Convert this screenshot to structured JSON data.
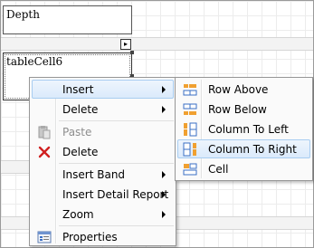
{
  "designer": {
    "cells": [
      {
        "text": "Depth"
      },
      {
        "text": "tableCell6"
      }
    ]
  },
  "context_menu": {
    "items": [
      {
        "label": "Insert",
        "icon": "none",
        "enabled": true,
        "submenu": true,
        "highlighted": false
      },
      {
        "label": "Delete",
        "icon": "none",
        "enabled": true,
        "submenu": true,
        "highlighted": false
      },
      {
        "label": "Paste",
        "icon": "paste-icon",
        "enabled": false,
        "submenu": false
      },
      {
        "label": "Delete",
        "icon": "delete-x-icon",
        "enabled": true,
        "submenu": false
      },
      {
        "label": "Insert Band",
        "icon": "none",
        "enabled": true,
        "submenu": true
      },
      {
        "label": "Insert Detail Report",
        "icon": "none",
        "enabled": true,
        "submenu": true
      },
      {
        "label": "Zoom",
        "icon": "none",
        "enabled": true,
        "submenu": true
      },
      {
        "label": "Properties",
        "icon": "properties-icon",
        "enabled": true,
        "submenu": false
      }
    ]
  },
  "insert_submenu": {
    "items": [
      {
        "label": "Row Above",
        "icon": "row-above-icon",
        "highlighted": false
      },
      {
        "label": "Row Below",
        "icon": "row-below-icon",
        "highlighted": false
      },
      {
        "label": "Column To Left",
        "icon": "column-left-icon",
        "highlighted": false
      },
      {
        "label": "Column To Right",
        "icon": "column-right-icon",
        "highlighted": true
      },
      {
        "label": "Cell",
        "icon": "cell-icon",
        "highlighted": false
      }
    ]
  },
  "colors": {
    "highlight_bg": "#dbeafb",
    "highlight_border": "#a8cdf1",
    "icon_orange": "#f0a030",
    "icon_blue": "#3a6fc4",
    "delete_red": "#d02020"
  }
}
